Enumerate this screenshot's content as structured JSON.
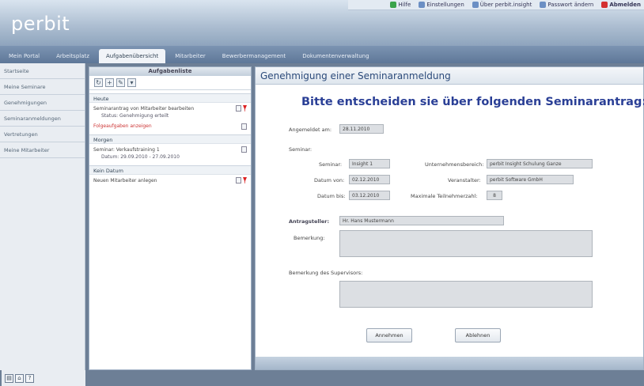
{
  "brand": {
    "logo": "perbit"
  },
  "toplinks": [
    {
      "label": "Hilfe",
      "color": "#3aa34a",
      "bold": false
    },
    {
      "label": "Einstellungen",
      "color": "#6b8fc4",
      "bold": false
    },
    {
      "label": "Über perbit.insight",
      "color": "#6b8fc4",
      "bold": false
    },
    {
      "label": "Passwort ändern",
      "color": "#6b8fc4",
      "bold": false
    },
    {
      "label": "Abmelden",
      "color": "#d43030",
      "bold": true
    }
  ],
  "nav": [
    {
      "label": "Mein Portal"
    },
    {
      "label": "Arbeitsplatz"
    },
    {
      "label": "Aufgabenübersicht",
      "active": true
    },
    {
      "label": "Mitarbeiter"
    },
    {
      "label": "Bewerbermanagement"
    },
    {
      "label": "Dokumentenverwaltung"
    }
  ],
  "sidebar": [
    {
      "label": "Startseite"
    },
    {
      "label": "Meine Seminare"
    },
    {
      "label": "Genehmigungen"
    },
    {
      "label": "Seminaranmeldungen"
    },
    {
      "label": "Vertretungen"
    },
    {
      "label": "Meine Mitarbeiter"
    }
  ],
  "tasks": {
    "title": "Aufgabenliste",
    "groups": [
      {
        "label": "Heute",
        "items": [
          {
            "text": "Seminarantrag von Mitarbeiter bearbeiten",
            "sub": "Status: Genehmigung erteilt",
            "icons": [
              "doc",
              "pin"
            ]
          },
          {
            "text": "Folgeaufgaben anzeigen",
            "sub": "",
            "icons": [
              "doc"
            ],
            "red": true
          }
        ]
      },
      {
        "label": "Morgen",
        "items": [
          {
            "text": "Seminar: Verkaufstraining 1",
            "sub": "Datum: 29.09.2010 - 27.09.2010",
            "icons": [
              "doc"
            ]
          }
        ]
      },
      {
        "label": "Kein Datum",
        "items": [
          {
            "text": "Neuen Mitarbeiter anlegen",
            "sub": "",
            "icons": [
              "doc",
              "pin"
            ]
          }
        ]
      }
    ]
  },
  "form": {
    "window_title": "Genehmigung einer Seminaranmeldung",
    "heading": "Bitte entscheiden sie über folgenden Seminarantrag:",
    "angemeldet_label": "Angemeldet am:",
    "angemeldet_value": "28.11.2010",
    "seminar_section": "Seminar:",
    "rows": [
      {
        "left_label": "Seminar:",
        "left_value": "Insight 1",
        "right_label": "Unternehmensbereich:",
        "right_value": "perbit Insight Schulung Ganze"
      },
      {
        "left_label": "Datum von:",
        "left_value": "02.12.2010",
        "right_label": "Veranstalter:",
        "right_value": "perbit Software GmbH"
      },
      {
        "left_label": "Datum bis:",
        "left_value": "03.12.2010",
        "right_label": "Maximale Teilnehmerzahl:",
        "right_value": "8"
      }
    ],
    "antragsteller_label": "Antragsteller:",
    "antragsteller_value": "Hr. Hans Mustermann",
    "bemerkung_label": "Bemerkung:",
    "bemerkung_sup_label": "Bemerkung des Supervisors:",
    "accept_label": "Annehmen",
    "reject_label": "Ablehnen"
  }
}
